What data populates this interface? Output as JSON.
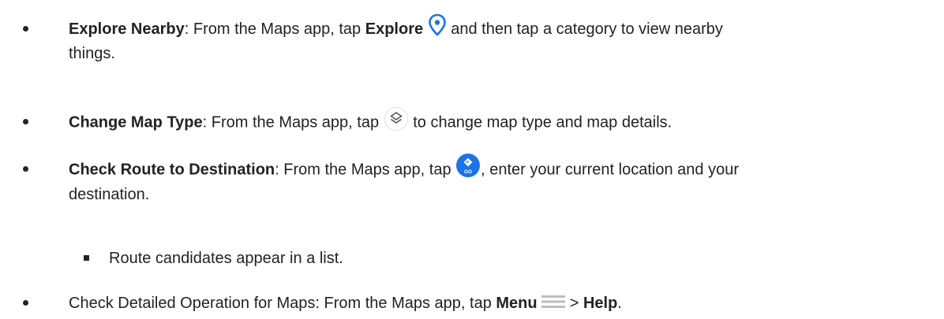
{
  "items": [
    {
      "title": "Explore Nearby",
      "text_a": ": From the Maps app, tap ",
      "bold_a": "Explore",
      "text_b": " and then tap a category to view nearby",
      "line2": "things.",
      "icon": "location-pin-icon"
    },
    {
      "title": "Change Map Type",
      "text_a": ": From the Maps app, tap ",
      "text_b": " to change map type and map details.",
      "icon": "map-layers-icon"
    },
    {
      "title": "Check Route to Destination",
      "text_a": ": From the Maps app, tap ",
      "text_b": ", enter your current location and your",
      "line2": "destination.",
      "icon": "directions-go-icon",
      "icon_text": "GO"
    },
    {
      "sub": "Route candidates appear in a list."
    },
    {
      "text_a": "Check Detailed Operation for Maps: From the Maps app, tap ",
      "bold_a": "Menu",
      "text_b": " > ",
      "bold_b": "Help",
      "text_c": ".",
      "icon": "menu-icon"
    }
  ],
  "colors": {
    "accent": "#1a73e8",
    "text": "#222222",
    "menu_icon": "#bdbdbd"
  }
}
